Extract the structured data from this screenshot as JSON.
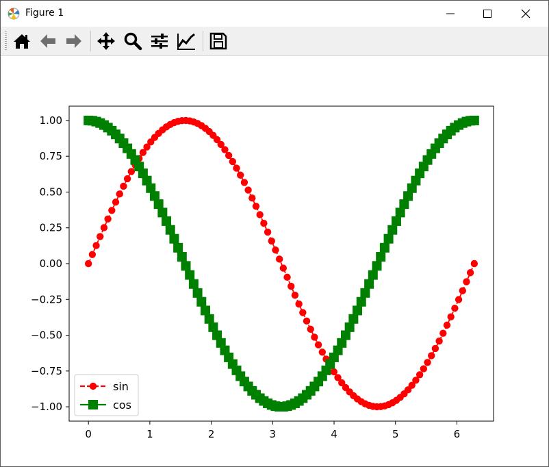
{
  "window": {
    "title": "Figure 1"
  },
  "toolbar": {
    "buttons": [
      {
        "name": "home-button",
        "icon": "home-icon"
      },
      {
        "name": "back-button",
        "icon": "arrow-left-icon"
      },
      {
        "name": "forward-button",
        "icon": "arrow-right-icon"
      },
      {
        "name": "pan-button",
        "icon": "move-icon"
      },
      {
        "name": "zoom-button",
        "icon": "magnifier-icon"
      },
      {
        "name": "subplots-button",
        "icon": "sliders-icon"
      },
      {
        "name": "axes-button",
        "icon": "line-chart-icon"
      },
      {
        "name": "save-button",
        "icon": "floppy-disk-icon"
      }
    ]
  },
  "chart_data": {
    "type": "line",
    "title": "",
    "xlabel": "",
    "ylabel": "",
    "xlim": [
      -0.314,
      6.597
    ],
    "ylim": [
      -1.1,
      1.1
    ],
    "x_ticks": [
      0,
      1,
      2,
      3,
      4,
      5,
      6
    ],
    "x_tick_labels": [
      "0",
      "1",
      "2",
      "3",
      "4",
      "5",
      "6"
    ],
    "y_ticks": [
      1.0,
      0.75,
      0.5,
      0.25,
      0.0,
      -0.25,
      -0.5,
      -0.75,
      -1.0
    ],
    "y_tick_labels": [
      "1.00",
      "0.75",
      "0.50",
      "0.25",
      "0.00",
      "−0.25",
      "−0.50",
      "−0.75",
      "−1.00"
    ],
    "grid": false,
    "legend_position": "lower-left",
    "x": [
      0.0,
      0.0635,
      0.127,
      0.1904,
      0.2539,
      0.3174,
      0.3808,
      0.4443,
      0.5078,
      0.5712,
      0.6347,
      0.6982,
      0.7616,
      0.8251,
      0.8886,
      0.952,
      1.0155,
      1.079,
      1.1424,
      1.2059,
      1.2693,
      1.3328,
      1.3963,
      1.4597,
      1.5232,
      1.5867,
      1.6501,
      1.7136,
      1.7771,
      1.8405,
      1.904,
      1.9675,
      2.0309,
      2.0944,
      2.1579,
      2.2213,
      2.2848,
      2.3483,
      2.4117,
      2.4752,
      2.5387,
      2.6021,
      2.6656,
      2.7291,
      2.7925,
      2.856,
      2.9195,
      2.9829,
      3.0464,
      3.1099,
      3.1733,
      3.2368,
      3.3003,
      3.3637,
      3.4272,
      3.4907,
      3.5541,
      3.6176,
      3.6811,
      3.7445,
      3.808,
      3.8715,
      3.9349,
      3.9984,
      4.0619,
      4.1253,
      4.1888,
      4.2523,
      4.3157,
      4.3792,
      4.4427,
      4.5061,
      4.5696,
      4.6331,
      4.6965,
      4.76,
      4.8235,
      4.8869,
      4.9504,
      5.0139,
      5.0773,
      5.1408,
      5.2043,
      5.2677,
      5.3312,
      5.3947,
      5.4581,
      5.5216,
      5.5851,
      5.6485,
      5.712,
      5.7755,
      5.8389,
      5.9024,
      5.9659,
      6.0293,
      6.0928,
      6.1563,
      6.2197,
      6.2832
    ],
    "series": [
      {
        "name": "sin",
        "color": "#ff0000",
        "marker": "circle",
        "line_style": "dashed",
        "values": [
          0.0,
          0.0634,
          0.1266,
          0.1893,
          0.2511,
          0.312,
          0.3717,
          0.4298,
          0.4862,
          0.5406,
          0.5929,
          0.6428,
          0.6901,
          0.7346,
          0.7761,
          0.8146,
          0.8497,
          0.8815,
          0.9096,
          0.9341,
          0.9549,
          0.9718,
          0.9848,
          0.9938,
          0.9989,
          0.9999,
          0.9969,
          0.9898,
          0.9788,
          0.9638,
          0.945,
          0.9224,
          0.896,
          0.866,
          0.8326,
          0.7958,
          0.7557,
          0.7127,
          0.6668,
          0.6182,
          0.5671,
          0.5137,
          0.4582,
          0.4009,
          0.342,
          0.2817,
          0.2203,
          0.158,
          0.0951,
          0.0317,
          -0.0317,
          -0.0951,
          -0.158,
          -0.2203,
          -0.2817,
          -0.342,
          -0.4009,
          -0.4582,
          -0.5137,
          -0.5671,
          -0.6182,
          -0.6668,
          -0.7127,
          -0.7557,
          -0.7958,
          -0.8326,
          -0.866,
          -0.896,
          -0.9224,
          -0.945,
          -0.9638,
          -0.9788,
          -0.9898,
          -0.9969,
          -0.9999,
          -0.9989,
          -0.9938,
          -0.9848,
          -0.9718,
          -0.9549,
          -0.9341,
          -0.9096,
          -0.8815,
          -0.8497,
          -0.8146,
          -0.7761,
          -0.7346,
          -0.6901,
          -0.6428,
          -0.5929,
          -0.5406,
          -0.4862,
          -0.4298,
          -0.3717,
          -0.312,
          -0.2511,
          -0.1893,
          -0.1266,
          -0.0634,
          0.0
        ]
      },
      {
        "name": "cos",
        "color": "#008000",
        "marker": "square",
        "line_style": "solid",
        "values": [
          1.0,
          0.998,
          0.992,
          0.9819,
          0.9679,
          0.95,
          0.9284,
          0.9029,
          0.8738,
          0.8413,
          0.8053,
          0.766,
          0.7237,
          0.6785,
          0.6305,
          0.5801,
          0.5272,
          0.4723,
          0.4155,
          0.3569,
          0.2969,
          0.2357,
          0.1736,
          0.1109,
          0.0476,
          -0.0159,
          -0.0792,
          -0.1423,
          -0.2048,
          -0.2665,
          -0.3271,
          -0.3863,
          -0.444,
          -0.5,
          -0.5539,
          -0.6056,
          -0.6549,
          -0.7015,
          -0.7453,
          -0.7861,
          -0.8237,
          -0.8579,
          -0.8887,
          -0.9158,
          -0.9397,
          -0.959,
          -0.9755,
          -0.9874,
          -0.9955,
          -0.9995,
          -0.9995,
          -0.9955,
          -0.9874,
          -0.9755,
          -0.959,
          -0.9397,
          -0.9158,
          -0.8887,
          -0.8579,
          -0.8237,
          -0.7861,
          -0.7453,
          -0.7015,
          -0.6549,
          -0.6056,
          -0.5539,
          -0.5,
          -0.444,
          -0.3863,
          -0.3271,
          -0.2665,
          -0.2048,
          -0.1423,
          -0.0792,
          -0.0159,
          0.0476,
          0.1109,
          0.1736,
          0.2357,
          0.2969,
          0.3569,
          0.4155,
          0.4723,
          0.5272,
          0.5801,
          0.6305,
          0.6785,
          0.7237,
          0.766,
          0.8053,
          0.8413,
          0.8738,
          0.9029,
          0.9284,
          0.95,
          0.9679,
          0.9819,
          0.992,
          0.998,
          1.0
        ]
      }
    ]
  }
}
